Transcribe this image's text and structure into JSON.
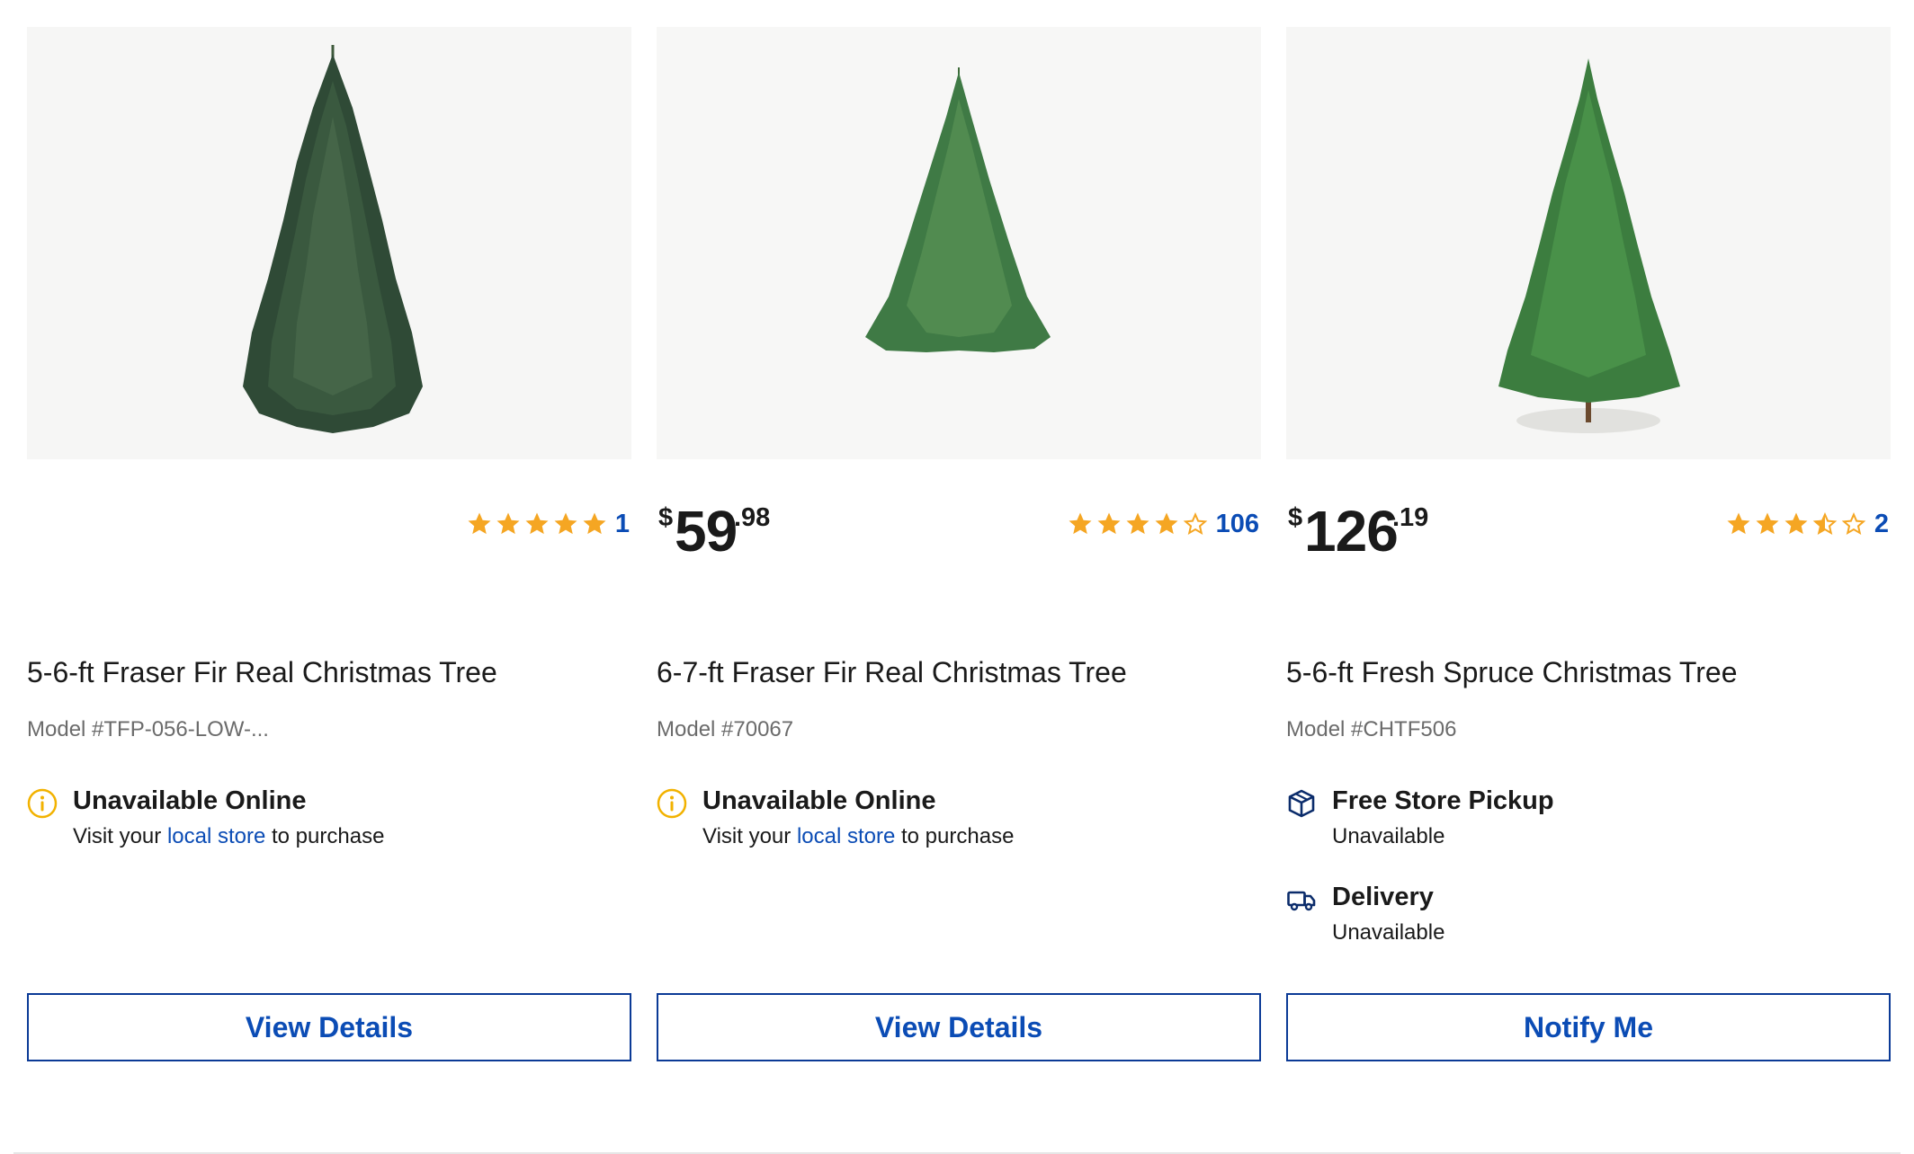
{
  "products": [
    {
      "image_alt": "5-6-ft Fraser Fir Real Christmas Tree",
      "price": {
        "currency": "",
        "dollars": "",
        "cents": ""
      },
      "rating": {
        "stars": 5,
        "count": "1"
      },
      "title": "5-6-ft Fraser Fir Real Christmas Tree",
      "model": "Model #TFP-056-LOW-...",
      "availability": [
        {
          "icon": "info-icon",
          "head": "Unavailable Online",
          "sub_pre": "Visit your ",
          "sub_link": "local store",
          "sub_post": " to purchase"
        }
      ],
      "button": "View Details"
    },
    {
      "image_alt": "6-7-ft Fraser Fir Real Christmas Tree",
      "price": {
        "currency": "$",
        "dollars": "59",
        "cents": ".98"
      },
      "rating": {
        "stars": 4,
        "count": "106"
      },
      "title": "6-7-ft Fraser Fir Real Christmas Tree",
      "model": "Model #70067",
      "availability": [
        {
          "icon": "info-icon",
          "head": "Unavailable Online",
          "sub_pre": "Visit your ",
          "sub_link": "local store",
          "sub_post": " to purchase"
        }
      ],
      "button": "View Details"
    },
    {
      "image_alt": "5-6-ft Fresh Spruce Christmas Tree",
      "price": {
        "currency": "$",
        "dollars": "126",
        "cents": ".19"
      },
      "rating": {
        "stars": 3.5,
        "count": "2"
      },
      "title": "5-6-ft Fresh Spruce Christmas Tree",
      "model": "Model #CHTF506",
      "availability": [
        {
          "icon": "store-pickup-icon",
          "head": "Free Store Pickup",
          "sub": "Unavailable"
        },
        {
          "icon": "delivery-truck-icon",
          "head": "Delivery",
          "sub": "Unavailable"
        }
      ],
      "button": "Notify Me"
    }
  ],
  "colors": {
    "star": "#f5a623",
    "link": "#0b4cb5",
    "button_border": "#0b3a96",
    "info": "#f2b200",
    "icon_navy": "#0b2c6b"
  }
}
